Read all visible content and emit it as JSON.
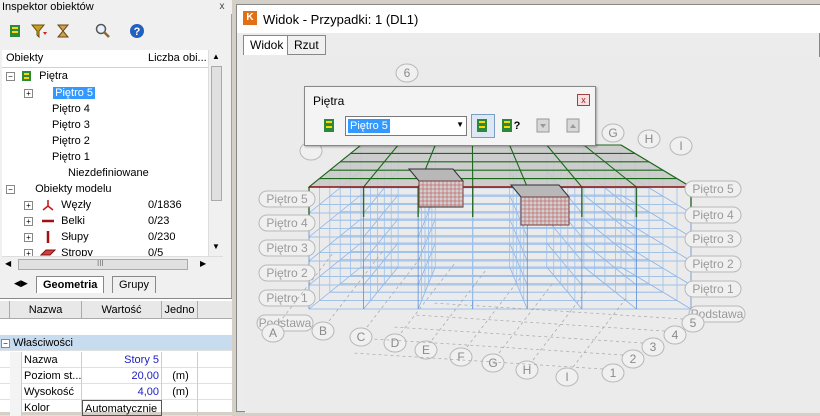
{
  "inspector": {
    "title": "Inspektor obiektów",
    "close_glyph": "x",
    "toolbar_icons": [
      "floor-select-icon",
      "filter-icon",
      "hourglass-filter-icon",
      "search-icon",
      "help-icon"
    ],
    "tree_columns": {
      "objects": "Obiekty",
      "count": "Liczba obi..."
    },
    "tree": [
      {
        "label": "Piętra",
        "level": 0,
        "expander": "−"
      },
      {
        "label": "Piętro 5",
        "level": 1,
        "expander": "+",
        "selected": true
      },
      {
        "label": "Piętro 4",
        "level": 1
      },
      {
        "label": "Piętro 3",
        "level": 1
      },
      {
        "label": "Piętro 2",
        "level": 1
      },
      {
        "label": "Piętro 1",
        "level": 1
      },
      {
        "label": "Niezdefiniowane",
        "level": 1
      },
      {
        "label": "Obiekty modelu",
        "level": 0,
        "expander": "−"
      },
      {
        "label": "Węzły",
        "level": 1,
        "expander": "+",
        "count": "0/1836"
      },
      {
        "label": "Belki",
        "level": 1,
        "expander": "+",
        "count": "0/23"
      },
      {
        "label": "Słupy",
        "level": 1,
        "expander": "+",
        "count": "0/230"
      },
      {
        "label": "Stropy",
        "level": 1,
        "expander": "+",
        "count": "0/5"
      }
    ],
    "scroll_glyph": "III",
    "tabs": [
      {
        "label": "Geometria",
        "active": true
      },
      {
        "label": "Grupy",
        "active": false
      }
    ],
    "props_columns": {
      "name": "Nazwa",
      "value": "Wartość",
      "unit": "Jedno"
    },
    "props_section": "Właściwości",
    "props_rows": [
      {
        "name": "Nazwa",
        "value": "Story 5",
        "unit": ""
      },
      {
        "name": "Poziom st...",
        "value": "20,00",
        "unit": "(m)"
      },
      {
        "name": "Wysokość",
        "value": "4,00",
        "unit": "(m)"
      },
      {
        "name": "Kolor",
        "value": "Automatycznie",
        "unit": ""
      }
    ]
  },
  "viewport": {
    "title": "Widok - Przypadki: 1 (DL1)",
    "tabs": [
      {
        "label": "Widok",
        "active": true
      },
      {
        "label": "Rzut",
        "active": false
      }
    ],
    "accent": "#3399ff"
  },
  "floor_panel": {
    "title": "Piętra",
    "selected_floor": "Piętro 5",
    "close_glyph": "x",
    "buttons": [
      "floor-visible-icon",
      "floor-query-icon",
      "floor-down-icon",
      "floor-up-icon"
    ]
  },
  "scene": {
    "left_floor_labels": [
      "Piętro 5",
      "Piętro 4",
      "Piętro 3",
      "Piętro 2",
      "Piętro 1",
      "Podstawa"
    ],
    "right_floor_labels": [
      "Piętro 5",
      "Piętro 4",
      "Piętro 3",
      "Piętro 2",
      "Piętro 1",
      "Podstawa"
    ],
    "axis_letters_front": [
      "A",
      "B",
      "C",
      "D",
      "E",
      "F",
      "G",
      "H",
      "I"
    ],
    "axis_numbers_right": [
      "1",
      "2",
      "3",
      "4",
      "5"
    ],
    "axis_back_letters": [
      "G",
      "H",
      "I"
    ],
    "axis_back_number": "6"
  }
}
